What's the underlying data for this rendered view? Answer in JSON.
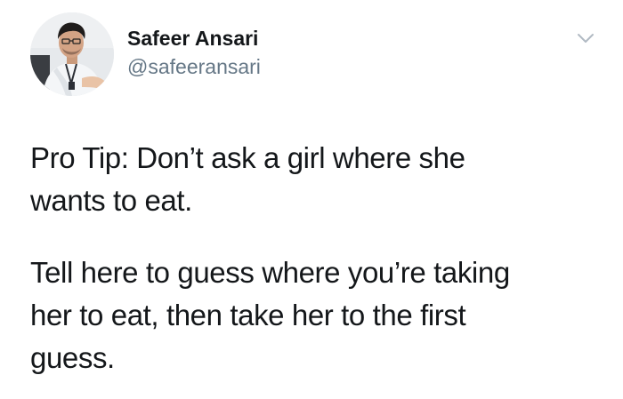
{
  "author": {
    "name": "Safeer Ansari",
    "handle": "@safeeransari",
    "avatar": "avatar-photo"
  },
  "menu": {
    "icon": "chevron-down-icon",
    "color": "#b1bac3"
  },
  "tweet": {
    "paragraph_1_line_1": "Pro Tip: Don’t ask a girl where she",
    "paragraph_1_line_2": "wants to eat.",
    "paragraph_2_line_1": "Tell here to guess where you’re taking",
    "paragraph_2_line_2": "her to eat, then take her to the first",
    "paragraph_2_line_3": "guess."
  },
  "colors": {
    "text": "#14171a",
    "secondary_text": "#657786",
    "background": "#ffffff"
  }
}
